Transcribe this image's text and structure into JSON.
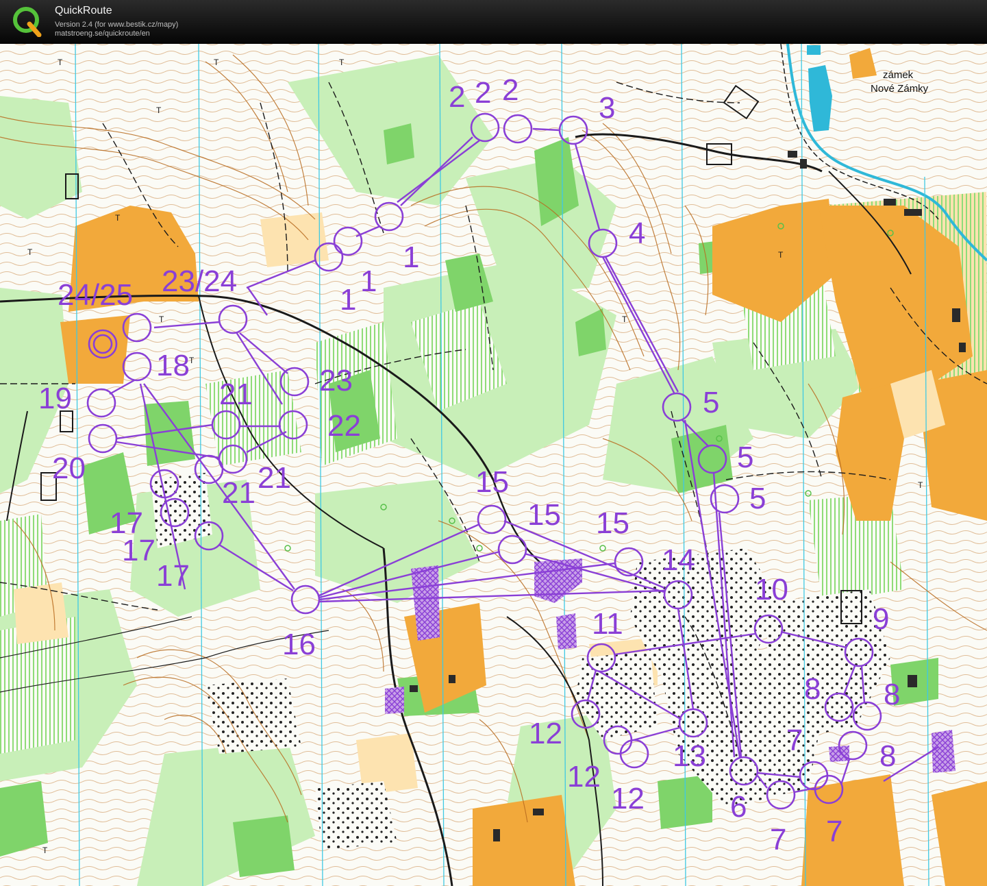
{
  "window": {
    "title": "QuickRoute",
    "version": "Version 2.4  (for www.bestik.cz/mapy)",
    "url": "matstroeng.se/quickroute/en"
  },
  "colors": {
    "titlebar": "#111111",
    "course": "#8a3fd6",
    "forest_green": "#7fd46a",
    "light_green": "#c8efb8",
    "open_land": "#f2a93b",
    "rough_open": "#fbd68f",
    "contour": "#b86b1f",
    "north_lines": "#3fc9e3",
    "water": "#2fb8d8",
    "paper": "#fbfbf6"
  },
  "map": {
    "place_names": [
      {
        "id": "castle-line1",
        "text": "zámek"
      },
      {
        "id": "castle-line2",
        "text": "Nové Zámky"
      }
    ],
    "control_labels": [
      {
        "text": "2"
      },
      {
        "text": "2"
      },
      {
        "text": "2"
      },
      {
        "text": "3"
      },
      {
        "text": "4"
      },
      {
        "text": "1"
      },
      {
        "text": "1"
      },
      {
        "text": "1"
      },
      {
        "text": "23/24"
      },
      {
        "text": "24/25"
      },
      {
        "text": "18"
      },
      {
        "text": "19"
      },
      {
        "text": "21"
      },
      {
        "text": "23"
      },
      {
        "text": "22"
      },
      {
        "text": "20"
      },
      {
        "text": "21"
      },
      {
        "text": "21"
      },
      {
        "text": "17"
      },
      {
        "text": "17"
      },
      {
        "text": "17"
      },
      {
        "text": "15"
      },
      {
        "text": "15"
      },
      {
        "text": "15"
      },
      {
        "text": "14"
      },
      {
        "text": "16"
      },
      {
        "text": "5"
      },
      {
        "text": "5"
      },
      {
        "text": "5"
      },
      {
        "text": "10"
      },
      {
        "text": "9"
      },
      {
        "text": "11"
      },
      {
        "text": "8"
      },
      {
        "text": "8"
      },
      {
        "text": "8"
      },
      {
        "text": "12"
      },
      {
        "text": "12"
      },
      {
        "text": "12"
      },
      {
        "text": "13"
      },
      {
        "text": "7"
      },
      {
        "text": "6"
      },
      {
        "text": "7"
      },
      {
        "text": "7"
      }
    ]
  }
}
